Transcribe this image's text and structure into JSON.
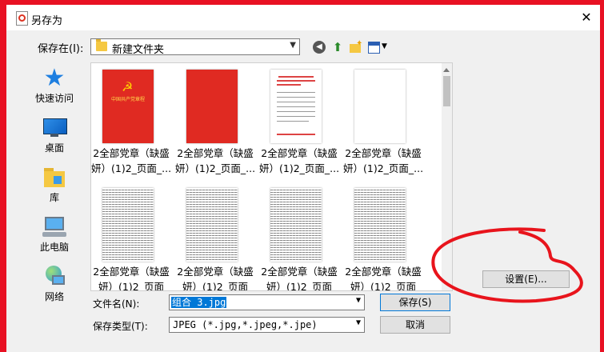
{
  "window": {
    "title": "另存为",
    "close_label": "✕"
  },
  "look_in": {
    "label": "保存在(I):",
    "value": "新建文件夹"
  },
  "toolbar": {
    "back_icon": "back-arrow-icon",
    "up_icon": "up-folder-icon",
    "new_folder_icon": "new-folder-icon",
    "view_icon": "view-menu-icon"
  },
  "places": [
    {
      "label": "快速访问",
      "icon": "star-icon"
    },
    {
      "label": "桌面",
      "icon": "desktop-icon"
    },
    {
      "label": "库",
      "icon": "library-icon"
    },
    {
      "label": "此电脑",
      "icon": "computer-icon"
    },
    {
      "label": "网络",
      "icon": "network-icon"
    }
  ],
  "files": [
    {
      "name_line1": "2全部党章（缺盛",
      "name_line2": "妍）(1)2_页面_...",
      "thumb": "red-cover"
    },
    {
      "name_line1": "2全部党章（缺盛",
      "name_line2": "妍）(1)2_页面_...",
      "thumb": "red-blank"
    },
    {
      "name_line1": "2全部党章（缺盛",
      "name_line2": "妍）(1)2_页面_...",
      "thumb": "name-list"
    },
    {
      "name_line1": "2全部党章（缺盛",
      "name_line2": "妍）(1)2_页面_...",
      "thumb": "blank"
    },
    {
      "name_line1": "2全部党章（缺盛",
      "name_line2": "妍）(1)2_页面",
      "thumb": "text"
    },
    {
      "name_line1": "2全部党章（缺盛",
      "name_line2": "妍）(1)2_页面",
      "thumb": "text"
    },
    {
      "name_line1": "2全部党章（缺盛",
      "name_line2": "妍）(1)2_页面",
      "thumb": "text"
    },
    {
      "name_line1": "2全部党章（缺盛",
      "name_line2": "妍）(1)2_页面",
      "thumb": "text"
    }
  ],
  "thumb_text": {
    "cover_title": "中国共产党章程"
  },
  "filename": {
    "label": "文件名(N):",
    "value": "组合 3.jpg"
  },
  "filetype": {
    "label": "保存类型(T):",
    "value": "JPEG (*.jpg,*.jpeg,*.jpe)"
  },
  "buttons": {
    "save": "保存(S)",
    "cancel": "取消",
    "settings": "设置(E)..."
  },
  "colors": {
    "background": "#e81123",
    "annotation": "#e8141c",
    "selection": "#0078d7"
  }
}
